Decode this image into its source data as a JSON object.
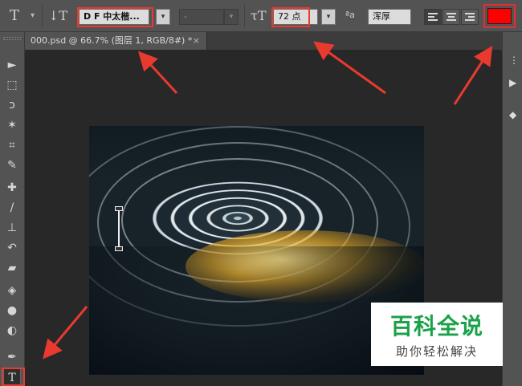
{
  "options_bar": {
    "tool_icon": "horizontal-type-tool-icon",
    "orientation_icon": "text-orientation-toggle-icon",
    "font_family": "D F 中太楷...",
    "font_style": "-",
    "size_icon": "font-size-icon",
    "font_size": "72 点",
    "aa_icon_label": "ªa",
    "anti_alias": "浑厚",
    "align_options": [
      "align-left",
      "align-center",
      "align-right"
    ],
    "text_color": "#ff0000"
  },
  "document": {
    "tab_title": "000.psd @ 66.7% (图层 1, RGB/8#) *",
    "close_glyph": "×"
  },
  "toolbar": {
    "tools": [
      "move",
      "marquee",
      "lasso",
      "magic-wand",
      "crop",
      "eyedropper",
      "healing-brush",
      "brush",
      "clone-stamp",
      "history-brush",
      "eraser",
      "paint-bucket",
      "blur",
      "dodge",
      "pen",
      "type"
    ],
    "active_tool": "type",
    "type_glyph": "T"
  },
  "watermark": {
    "title": "百科全说",
    "subtitle": "助你轻松解决"
  },
  "annotations": {
    "highlight_color": "#e83a2e"
  }
}
